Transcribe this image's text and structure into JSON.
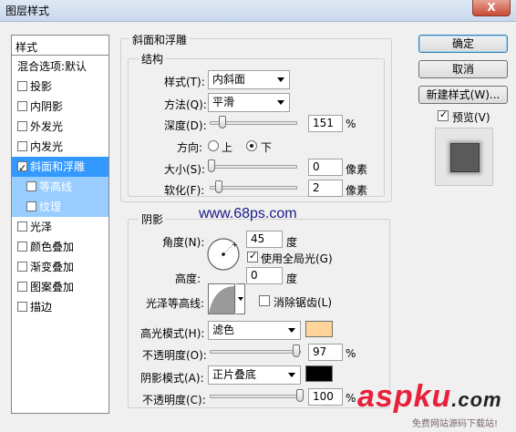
{
  "window": {
    "title": "图层样式",
    "close": "X"
  },
  "style_list": {
    "header": "样式",
    "items": [
      {
        "label": "混合选项:默认",
        "checkbox": false,
        "checked": false
      },
      {
        "label": "投影",
        "checkbox": true,
        "checked": false
      },
      {
        "label": "内阴影",
        "checkbox": true,
        "checked": false
      },
      {
        "label": "外发光",
        "checkbox": true,
        "checked": false
      },
      {
        "label": "内发光",
        "checkbox": true,
        "checked": false
      },
      {
        "label": "斜面和浮雕",
        "checkbox": true,
        "checked": true,
        "selected": true
      },
      {
        "label": "等高线",
        "checkbox": true,
        "checked": false,
        "sub": true
      },
      {
        "label": "纹理",
        "checkbox": true,
        "checked": false,
        "sub": true
      },
      {
        "label": "光泽",
        "checkbox": true,
        "checked": false
      },
      {
        "label": "颜色叠加",
        "checkbox": true,
        "checked": false
      },
      {
        "label": "渐变叠加",
        "checkbox": true,
        "checked": false
      },
      {
        "label": "图案叠加",
        "checkbox": true,
        "checked": false
      },
      {
        "label": "描边",
        "checkbox": true,
        "checked": false
      }
    ]
  },
  "bevel": {
    "section_title": "斜面和浮雕",
    "structure_title": "结构",
    "style_label": "样式(T):",
    "style_value": "内斜面",
    "technique_label": "方法(Q):",
    "technique_value": "平滑",
    "depth_label": "深度(D):",
    "depth_value": "151",
    "depth_level": 0.151,
    "depth_unit": "%",
    "direction_label": "方向:",
    "direction_up": "上",
    "direction_down": "下",
    "size_label": "大小(S):",
    "size_value": "0",
    "size_unit": "像素",
    "soften_label": "软化(F):",
    "soften_value": "2",
    "soften_unit": "像素"
  },
  "shading": {
    "title": "阴影",
    "angle_label": "角度(N):",
    "angle_value": "45",
    "angle_unit": "度",
    "global_light_label": "使用全局光(G)",
    "global_light_checked": true,
    "altitude_label": "高度:",
    "altitude_value": "0",
    "altitude_unit": "度",
    "gloss_contour_label": "光泽等高线:",
    "antialias_label": "消除锯齿(L)",
    "highlight_mode_label": "高光模式(H):",
    "highlight_mode_value": "滤色",
    "highlight_color": "#ffd49a",
    "highlight_opacity_label": "不透明度(O):",
    "highlight_opacity_value": "97",
    "highlight_opacity_unit": "%",
    "shadow_mode_label": "阴影模式(A):",
    "shadow_mode_value": "正片叠底",
    "shadow_color": "#000000",
    "shadow_opacity_label": "不透明度(C):",
    "shadow_opacity_value": "100",
    "shadow_opacity_unit": "%"
  },
  "buttons": {
    "ok": "确定",
    "cancel": "取消",
    "new_style": "新建样式(W)...",
    "preview_label": "预览(V)",
    "preview_checked": true
  },
  "watermarks": {
    "site1": "www.68ps.com",
    "aspku_brand": "aspku",
    "aspku_domain": ".com",
    "aspku_tagline": "免费网站源码下载站!"
  },
  "colors": {
    "selection": "#3399ff",
    "sub_selection": "#99ccff"
  }
}
